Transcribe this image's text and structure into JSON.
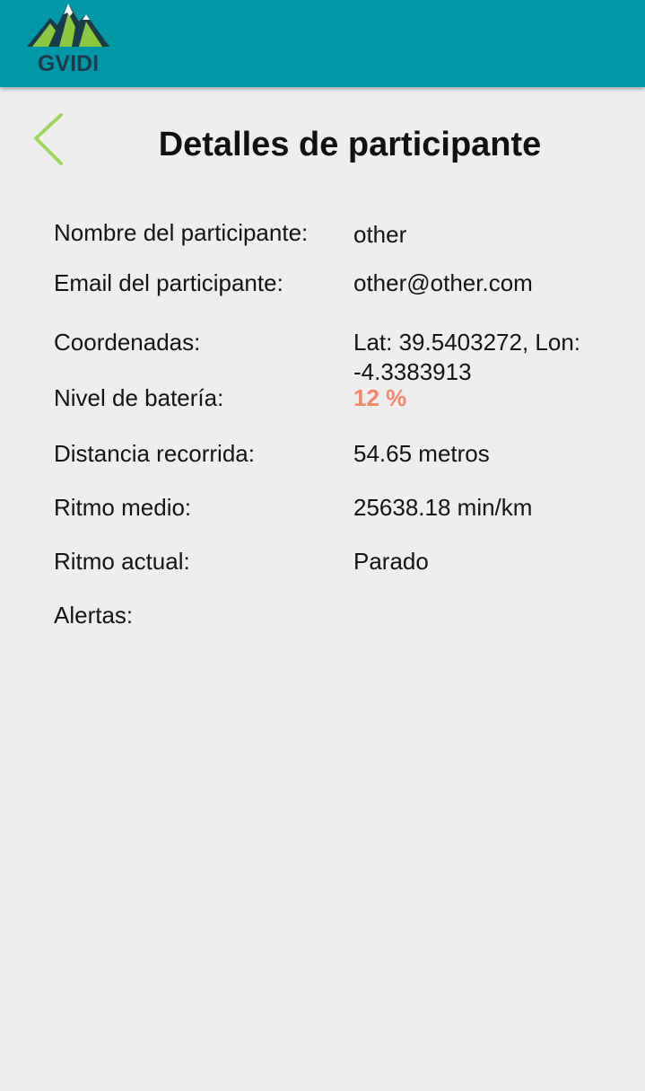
{
  "header": {
    "logo_text": "GVIDI",
    "colors": {
      "bar": "#0097a7",
      "mountain_dark": "#1c3b4a",
      "mountain_green": "#8dc63f",
      "snow": "#ffffff"
    }
  },
  "back_icon": "chevron-left-icon",
  "title": "Detalles de participante",
  "fields": {
    "nombre": {
      "label": "Nombre del participante:",
      "value": "other"
    },
    "email": {
      "label": "Email del participante:",
      "value": "other@other.com"
    },
    "coordenadas": {
      "label": "Coordenadas:",
      "value_line1": "Lat: 39.5403272, Lon:",
      "value_line2": "-4.3383913"
    },
    "bateria": {
      "label": "Nivel de batería:",
      "value": "12 %",
      "color": "#f4876a"
    },
    "distancia": {
      "label": "Distancia recorrida:",
      "value": "54.65 metros"
    },
    "ritmo_medio": {
      "label": "Ritmo medio:",
      "value": "25638.18 min/km"
    },
    "ritmo_actual": {
      "label": "Ritmo actual:",
      "value": "Parado"
    },
    "alertas": {
      "label": "Alertas:",
      "value": ""
    }
  }
}
